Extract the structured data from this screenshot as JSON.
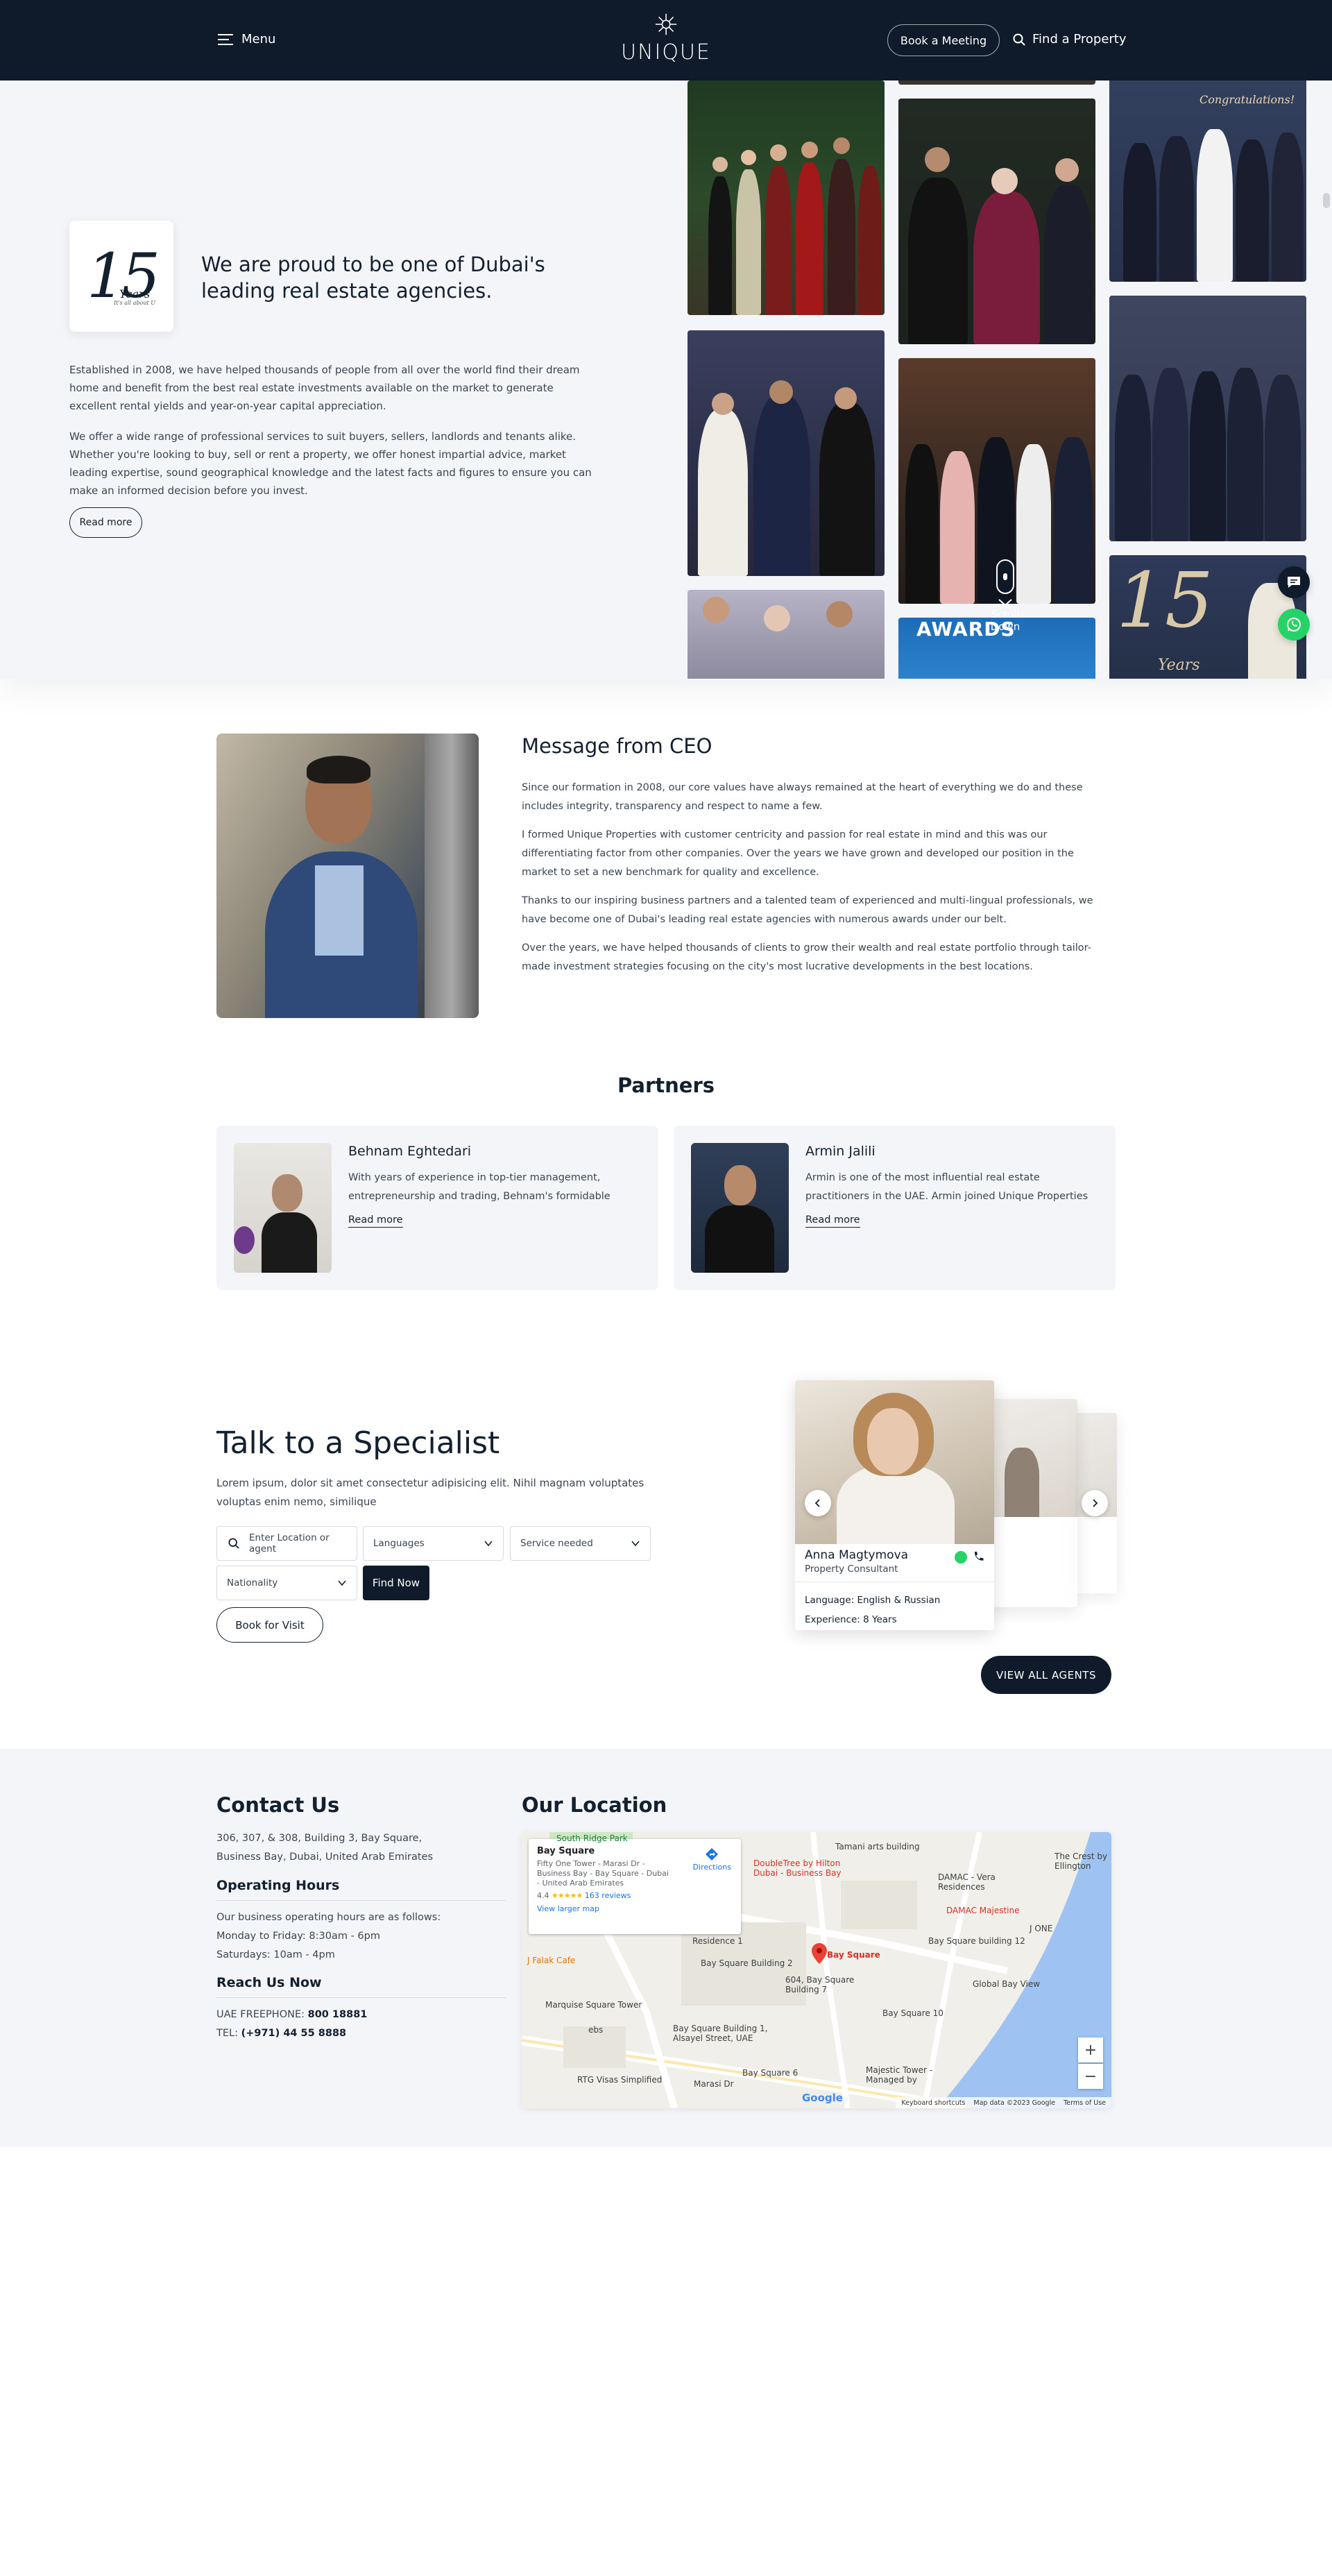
{
  "header": {
    "menu_label": "Menu",
    "logo_text": "UNIQUE",
    "book_meeting": "Book a Meeting",
    "find_property": "Find a Property"
  },
  "hero": {
    "badge": {
      "number": "15",
      "word": "Years",
      "tagline": "It's all about U"
    },
    "title": "We are proud to be one of Dubai's leading real estate agencies.",
    "paragraph_1": "Established in 2008, we have helped thousands of people from all over the world find their dream home and benefit from the best real estate investments available on the market to generate excellent rental yields and year-on-year capital appreciation.",
    "paragraph_2": "We offer a wide range of professional services to suit buyers, sellers, landlords and tenants alike. Whether you're looking to buy, sell or rent a property, we offer honest impartial advice, market leading expertise, sound geographical knowledge and the latest facts and figures to ensure you can make an informed decision before you invest.",
    "read_more": "Read more",
    "scroll_down": "Scroll Down",
    "gallery_texts": {
      "congrats": "Congratulations!",
      "awards": "AWARDS",
      "years": "Years"
    }
  },
  "ceo": {
    "title": "Message from CEO",
    "paragraphs": [
      "Since our formation in 2008, our core values have always remained at the heart of everything we do and these includes integrity, transparency and respect to name a few.",
      "I formed Unique Properties with customer centricity and passion for real estate in mind and this was our differentiating factor from other companies. Over the years we have grown and developed our position in the market to set a new benchmark for quality and excellence.",
      "Thanks to our inspiring business partners and a talented team of experienced and multi-lingual professionals, we have become one of Dubai's leading real estate agencies with numerous awards under our belt.",
      "Over the years, we have helped thousands of clients to grow their wealth and real estate portfolio through tailor-made investment strategies focusing on the city's most lucrative developments in the best locations."
    ]
  },
  "partners": {
    "title": "Partners",
    "items": [
      {
        "name": "Behnam Eghtedari",
        "text": "With years of experience in top-tier management, entrepreneurship and trading, Behnam's formidable skills,",
        "link": "Read more"
      },
      {
        "name": "Armin Jalili",
        "text": "Armin is one of the most influential real estate practitioners in the UAE. Armin joined Unique Properties during",
        "link": "Read more"
      }
    ]
  },
  "specialist": {
    "title": "Talk to a Specialist",
    "text": "Lorem ipsum, dolor sit amet consectetur adipisicing elit. Nihil magnam voluptates voluptas enim nemo, similique",
    "search_placeholder": "Enter Location or agent",
    "languages": "Languages",
    "service": "Service needed",
    "nationality": "Nationality",
    "find_now": "Find Now",
    "book_visit": "Book for Visit",
    "agent": {
      "name": "Anna Magtymova",
      "role": "Property Consultant",
      "language": "Language: English & Russian",
      "experience": "Experience: 8 Years"
    },
    "view_all": "VIEW ALL AGENTS"
  },
  "contact": {
    "title": "Contact Us",
    "address": "306, 307, & 308, Building 3, Bay Square, Business Bay, Dubai, United Arab Emirates",
    "hours_title": "Operating Hours",
    "hours_intro": "Our business operating hours are as follows:",
    "hours_weekday": "Monday to Friday: 8:30am - 6pm",
    "hours_saturday": "Saturdays: 10am - 4pm",
    "reach_title": "Reach Us Now",
    "freephone_label": "UAE FREEPHONE:",
    "freephone": "800 18881",
    "tel_label": "TEL:",
    "tel": "(+971) 44 55 8888"
  },
  "location": {
    "title": "Our Location",
    "card": {
      "name": "Bay Square",
      "address": "Fifty One Tower - Marasi Dr - Business Bay - Bay Square - Dubai - United Arab Emirates",
      "rating": "4.4",
      "stars": "★★★★★",
      "reviews": "163 reviews",
      "larger_map": "View larger map",
      "directions": "Directions"
    },
    "labels": {
      "south_ridge": "South Ridge Park",
      "tamani": "Tamani arts building",
      "doubletree": "DoubleTree by Hilton Dubai - Business Bay",
      "damac_vera": "DAMAC - Vera Residences",
      "damac_majestine": "DAMAC Majestine",
      "crest": "The Crest by Ellington",
      "residence1": "Residence 1",
      "bsq12": "Bay Square building 12",
      "jone": "J ONE",
      "jfalak": "J Falak Cafe",
      "bsq2": "Bay Square Building 2",
      "baysquare_pin": "Bay Square",
      "b604": "604, Bay Square Building 7",
      "gbv": "Global Bay View",
      "marquise": "Marquise Square Tower",
      "bsq10": "Bay Square 10",
      "bsq1": "Bay Square Building 1, Alsayel Street, UAE",
      "ebs": "ebs",
      "rtg": "RTG Visas Simplified",
      "bsq6": "Bay Square 6",
      "majestic": "Majestic Tower - Managed by",
      "marasi": "Marasi Dr",
      "google": "Google",
      "shortcuts": "Keyboard shortcuts",
      "map_data": "Map data ©2023 Google",
      "terms": "Terms of Use"
    }
  },
  "colors": {
    "navy": "#0f1b2b",
    "light_bg": "#f4f5f8",
    "whatsapp": "#25d366"
  },
  "icons": [
    "hamburger-menu-icon",
    "unique-logo-icon",
    "search-icon",
    "chat-icon",
    "whatsapp-icon",
    "chevron-down-icon",
    "arrow-left-icon",
    "arrow-right-icon",
    "phone-icon",
    "map-pin-icon",
    "directions-icon"
  ]
}
